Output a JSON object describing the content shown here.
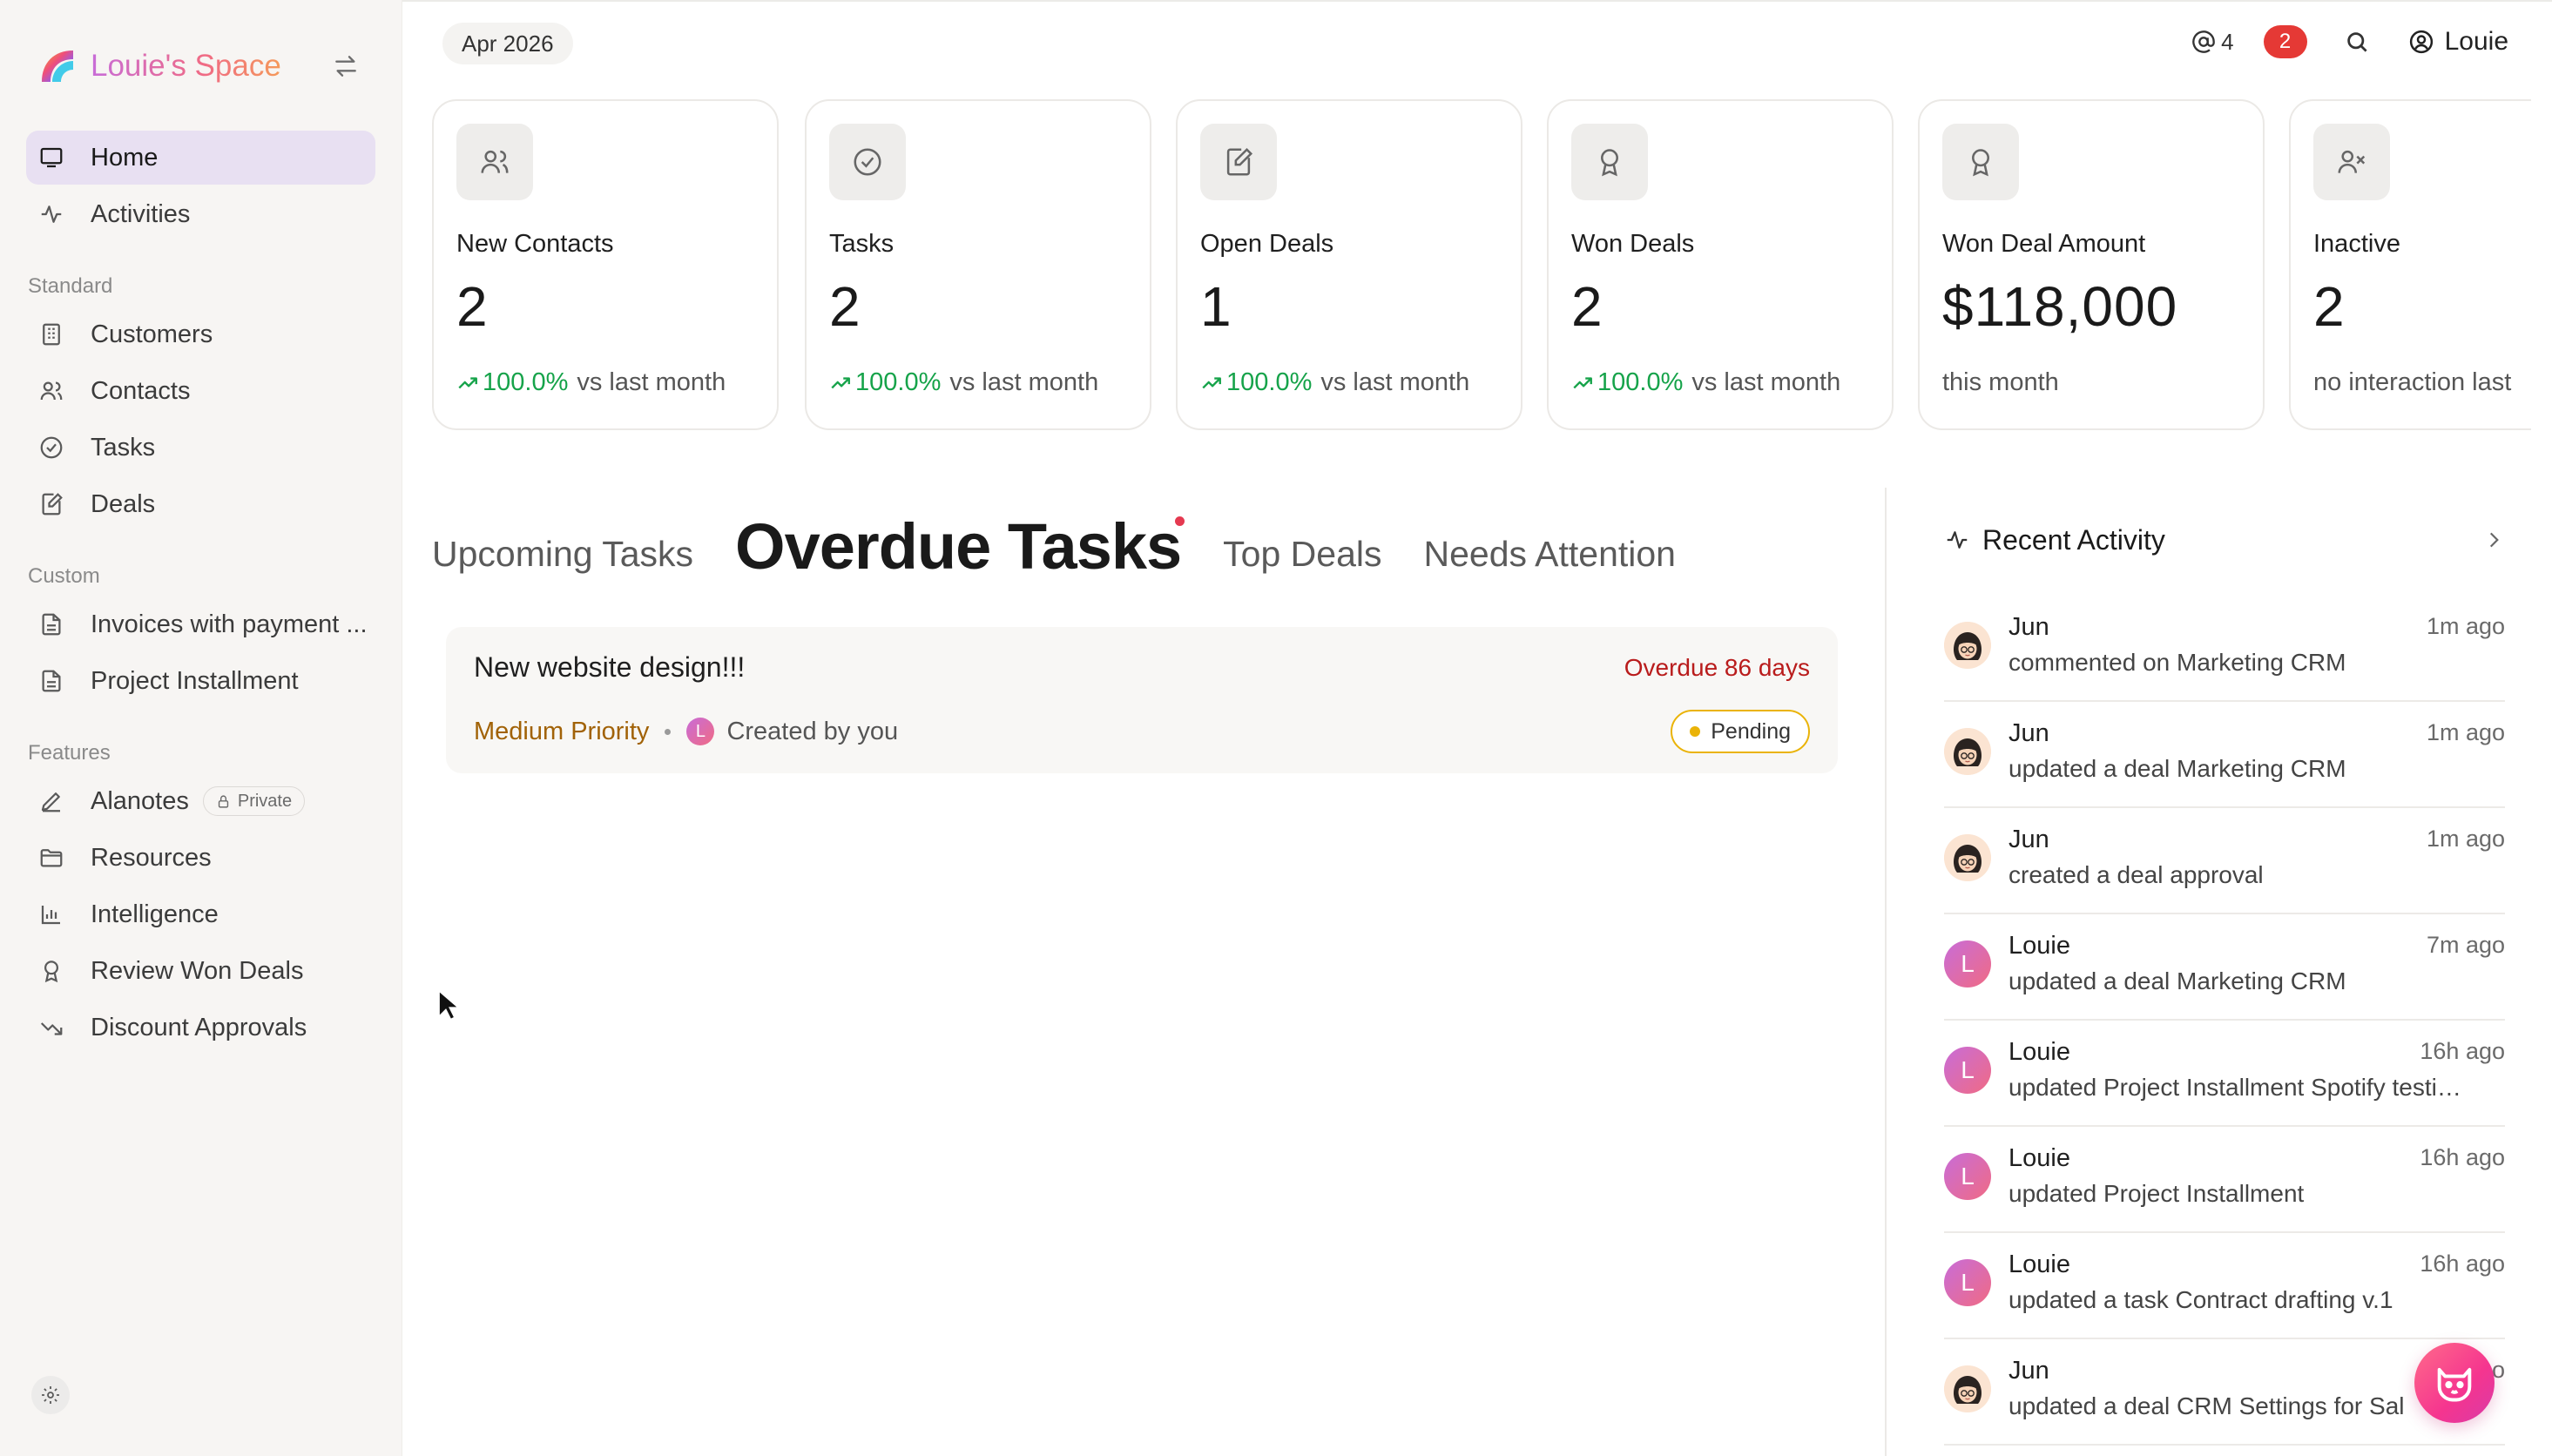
{
  "brand": {
    "name": "Louie's Space"
  },
  "sidebar": {
    "main": [
      {
        "label": "Home",
        "icon": "monitor-icon",
        "active": true
      },
      {
        "label": "Activities",
        "icon": "pulse-icon"
      }
    ],
    "standard_label": "Standard",
    "standard": [
      {
        "label": "Customers",
        "icon": "building-icon"
      },
      {
        "label": "Contacts",
        "icon": "users-icon"
      },
      {
        "label": "Tasks",
        "icon": "check-circle-icon"
      },
      {
        "label": "Deals",
        "icon": "edit-doc-icon"
      }
    ],
    "custom_label": "Custom",
    "custom": [
      {
        "label": "Invoices with payment ...",
        "icon": "document-icon"
      },
      {
        "label": "Project Installment",
        "icon": "document-icon"
      }
    ],
    "features_label": "Features",
    "features": [
      {
        "label": "Alanotes",
        "icon": "pen-icon",
        "badge": "Private"
      },
      {
        "label": "Resources",
        "icon": "folder-icon"
      },
      {
        "label": "Intelligence",
        "icon": "bar-chart-icon"
      },
      {
        "label": "Review Won Deals",
        "icon": "award-icon"
      },
      {
        "label": "Discount Approvals",
        "icon": "trend-down-icon"
      }
    ]
  },
  "topbar": {
    "date": "Apr 2026",
    "mentions": "4",
    "notifications": "2",
    "user": "Louie"
  },
  "cards": [
    {
      "title": "New Contacts",
      "value": "2",
      "pct": "100.0%",
      "suffix": "vs last month",
      "icon": "users-icon"
    },
    {
      "title": "Tasks",
      "value": "2",
      "pct": "100.0%",
      "suffix": "vs last month",
      "icon": "check-circle-icon"
    },
    {
      "title": "Open Deals",
      "value": "1",
      "pct": "100.0%",
      "suffix": "vs last month",
      "icon": "edit-doc-icon"
    },
    {
      "title": "Won Deals",
      "value": "2",
      "pct": "100.0%",
      "suffix": "vs last month",
      "icon": "award-icon"
    },
    {
      "title": "Won Deal Amount",
      "value": "$118,000",
      "pct": "",
      "suffix": "this month",
      "icon": "award-icon"
    },
    {
      "title": "Inactive",
      "value": "2",
      "pct": "",
      "suffix": "no interaction last",
      "icon": "user-x-icon"
    }
  ],
  "tabs": {
    "upcoming": "Upcoming Tasks",
    "overdue": "Overdue Tasks",
    "top_deals": "Top Deals",
    "needs_attention": "Needs Attention"
  },
  "task": {
    "title": "New website design!!!",
    "overdue": "Overdue 86 days",
    "priority": "Medium Priority",
    "creator_initial": "L",
    "created": "Created by you",
    "status": "Pending"
  },
  "activity": {
    "title": "Recent Activity",
    "items": [
      {
        "name": "Jun",
        "desc": "commented on Marketing CRM",
        "time": "1m ago",
        "avatar": "jun"
      },
      {
        "name": "Jun",
        "desc": "updated a deal Marketing CRM",
        "time": "1m ago",
        "avatar": "jun"
      },
      {
        "name": "Jun",
        "desc": "created a deal approval",
        "time": "1m ago",
        "avatar": "jun"
      },
      {
        "name": "Louie",
        "desc": "updated a deal Marketing CRM",
        "time": "7m ago",
        "avatar": "louie"
      },
      {
        "name": "Louie",
        "desc": "updated Project Installment Spotify testi…",
        "time": "16h ago",
        "avatar": "louie"
      },
      {
        "name": "Louie",
        "desc": "updated Project Installment",
        "time": "16h ago",
        "avatar": "louie"
      },
      {
        "name": "Louie",
        "desc": "updated a task Contract drafting v.1",
        "time": "16h ago",
        "avatar": "louie"
      },
      {
        "name": "Jun",
        "desc": "updated a deal CRM Settings for Sal",
        "time": "1m ago",
        "avatar": "jun"
      }
    ]
  },
  "colors": {
    "accent": "#e8e0f2",
    "positive": "#16a34a",
    "danger": "#b91c1c",
    "warning": "#eab308"
  }
}
